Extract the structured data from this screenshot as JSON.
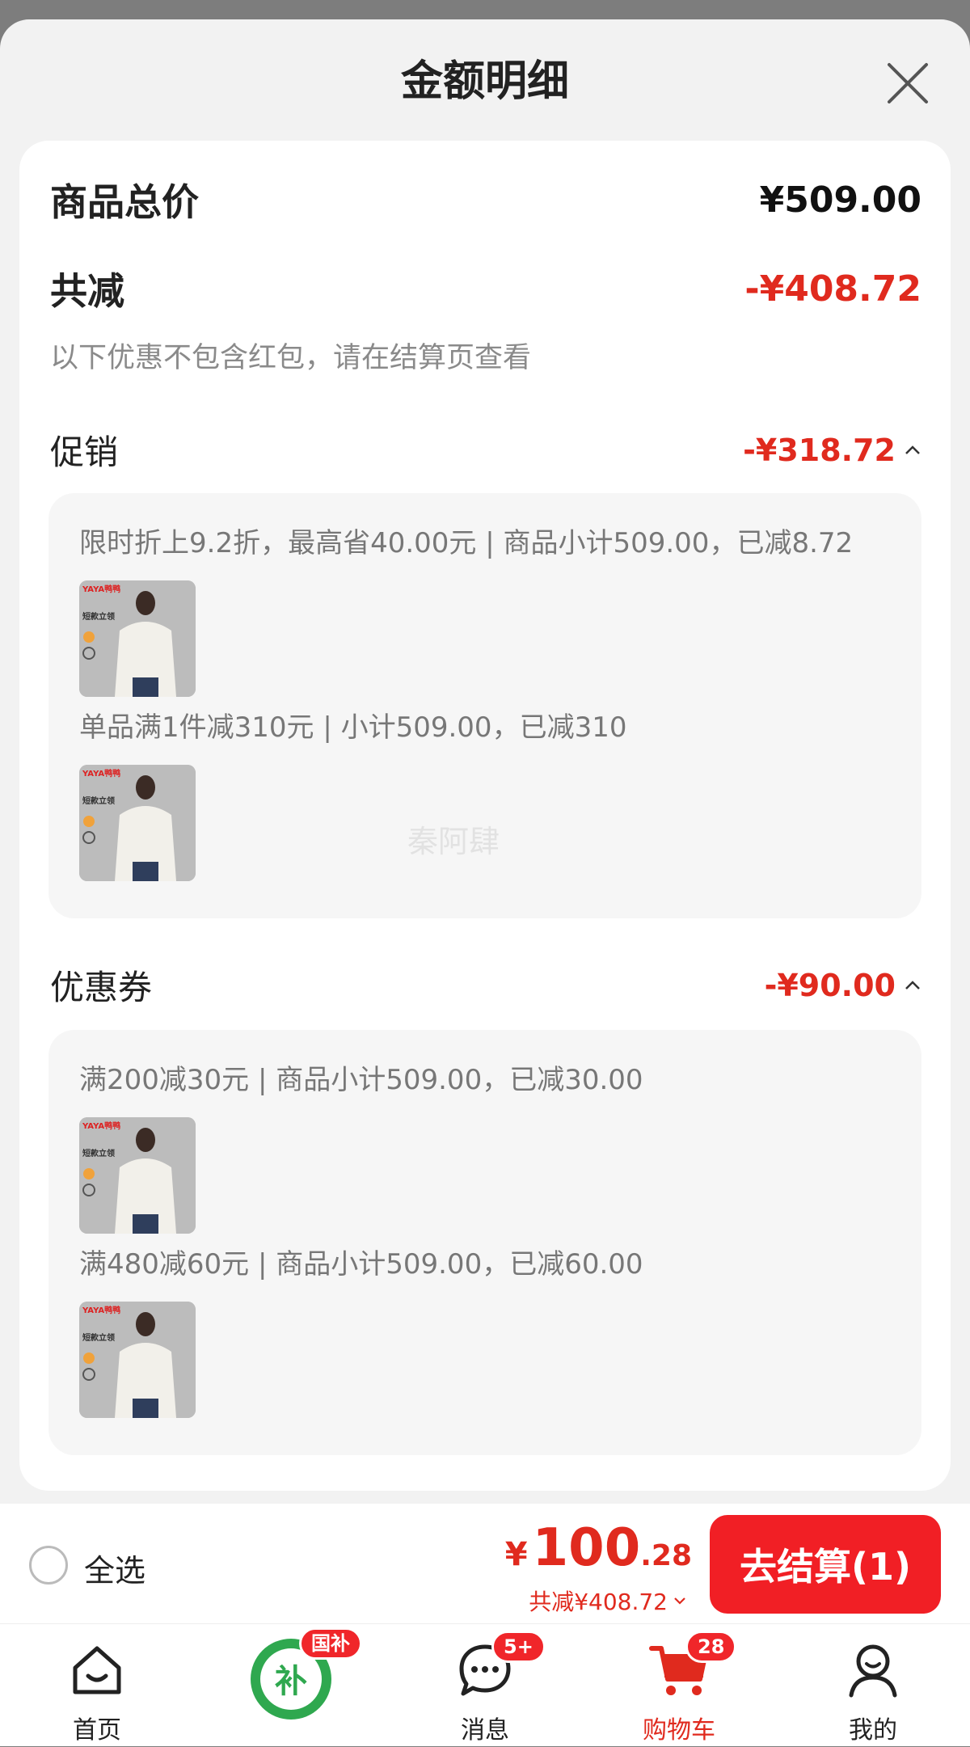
{
  "sheet": {
    "title": "金额明细"
  },
  "summary": {
    "total_label": "商品总价",
    "total_value": "¥509.00",
    "reduce_label": "共减",
    "reduce_value": "-¥408.72",
    "note": "以下优惠不包含红包，请在结算页查看"
  },
  "promo": {
    "label": "促销",
    "value": "-¥318.72",
    "items": [
      {
        "text": "限时折上9.2折，最高省40.00元 | 商品小计509.00，已减8.72"
      },
      {
        "text": "单品满1件减310元 | 小计509.00，已减310"
      }
    ]
  },
  "coupon": {
    "label": "优惠券",
    "value": "-¥90.00",
    "items": [
      {
        "text": "满200减30元 | 商品小计509.00，已减30.00"
      },
      {
        "text": "满480减60元 | 商品小计509.00，已减60.00"
      }
    ]
  },
  "thumb_text": {
    "brand": "YAYA鸭鸭",
    "tag": "短款立领"
  },
  "watermark": "秦阿肆",
  "bottom": {
    "select_all": "全选",
    "yen": "¥",
    "price_int": "100",
    "price_dec": ".28",
    "saved": "共减¥408.72",
    "checkout": "去结算(1)"
  },
  "tabs": [
    {
      "label": "首页",
      "icon": "home-icon"
    },
    {
      "label": "",
      "icon": "subsidy-icon",
      "badge": "国补",
      "glyph": "补"
    },
    {
      "label": "消息",
      "icon": "message-icon",
      "badge": "5+"
    },
    {
      "label": "购物车",
      "icon": "cart-icon",
      "badge": "28",
      "active": true
    },
    {
      "label": "我的",
      "icon": "user-icon"
    }
  ],
  "colors": {
    "accent": "#e02a1e",
    "checkout_bg": "#f11f25",
    "subsidy_green": "#2fa84f"
  }
}
